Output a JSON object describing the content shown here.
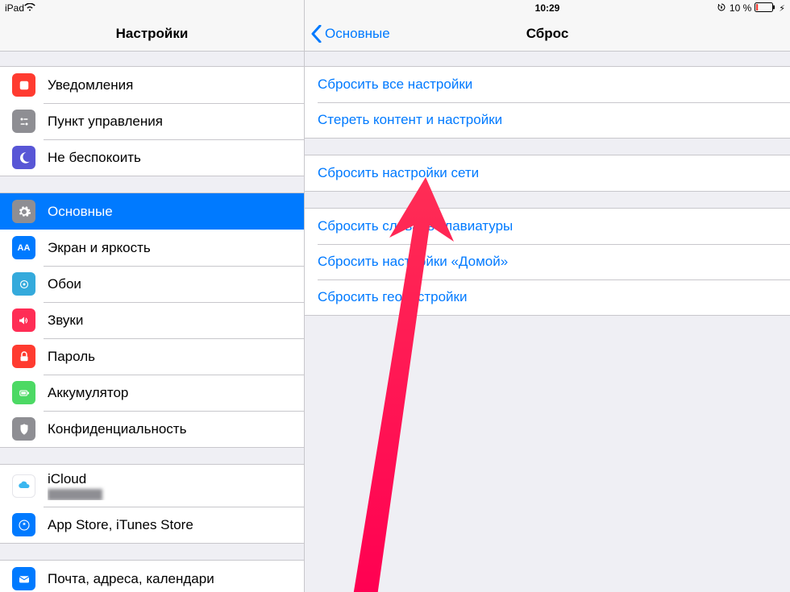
{
  "status": {
    "device": "iPad",
    "time": "10:29",
    "battery_text": "10 %"
  },
  "left": {
    "title": "Настройки",
    "groups": [
      [
        {
          "label": "Уведомления",
          "icon": "notifications-icon"
        },
        {
          "label": "Пункт управления",
          "icon": "control-center-icon"
        },
        {
          "label": "Не беспокоить",
          "icon": "dnd-icon"
        }
      ],
      [
        {
          "label": "Основные",
          "icon": "gear-icon",
          "selected": true
        },
        {
          "label": "Экран и яркость",
          "icon": "display-icon"
        },
        {
          "label": "Обои",
          "icon": "wallpaper-icon"
        },
        {
          "label": "Звуки",
          "icon": "sounds-icon"
        },
        {
          "label": "Пароль",
          "icon": "passcode-icon"
        },
        {
          "label": "Аккумулятор",
          "icon": "battery-icon"
        },
        {
          "label": "Конфиденциальность",
          "icon": "privacy-icon"
        }
      ],
      [
        {
          "label": "iCloud",
          "icon": "icloud-icon",
          "sub": "████████"
        },
        {
          "label": "App Store, iTunes Store",
          "icon": "appstore-icon"
        }
      ],
      [
        {
          "label": "Почта, адреса, календари",
          "icon": "mail-icon"
        }
      ]
    ]
  },
  "right": {
    "back_label": "Основные",
    "title": "Сброс",
    "groups": [
      [
        "Сбросить все настройки",
        "Стереть контент и настройки"
      ],
      [
        "Сбросить настройки сети"
      ],
      [
        "Сбросить словарь клавиатуры",
        "Сбросить настройки «Домой»",
        "Сбросить геонастройки"
      ]
    ]
  }
}
